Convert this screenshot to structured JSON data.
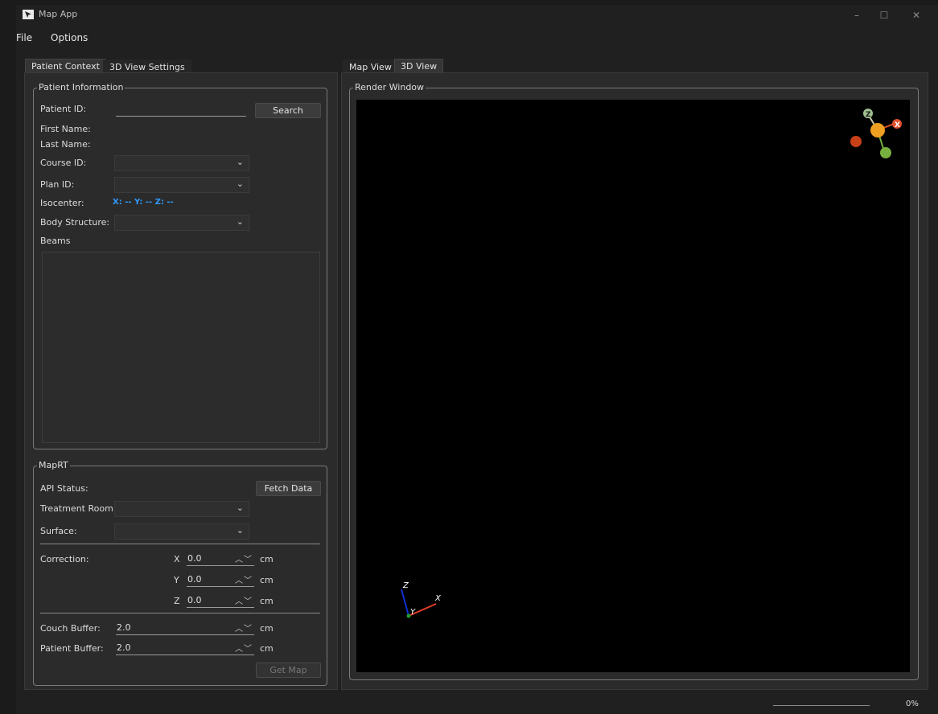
{
  "window": {
    "title": "Map App"
  },
  "menu": {
    "items": [
      "File",
      "Options"
    ]
  },
  "left_tabs": [
    {
      "label": "Patient Context",
      "active": true
    },
    {
      "label": "3D View Settings",
      "active": false
    }
  ],
  "right_tabs": [
    {
      "label": "Map View",
      "active": false
    },
    {
      "label": "3D View",
      "active": true
    }
  ],
  "patient_info": {
    "group_title": "Patient Information",
    "patient_id_label": "Patient ID:",
    "patient_id_value": "",
    "search_label": "Search",
    "first_name_label": "First Name:",
    "last_name_label": "Last Name:",
    "course_id_label": "Course ID:",
    "plan_id_label": "Plan ID:",
    "isocenter_label": "Isocenter:",
    "isocenter_value": "X: -- Y: -- Z: --",
    "body_structure_label": "Body Structure:",
    "beams_label": "Beams"
  },
  "maprt": {
    "group_title": "MapRT",
    "api_status_label": "API Status:",
    "fetch_label": "Fetch Data",
    "treatment_room_label": "Treatment Room:",
    "surface_label": "Surface:",
    "correction_label": "Correction:",
    "corrections": [
      {
        "axis": "X",
        "value": "0.0",
        "unit": "cm"
      },
      {
        "axis": "Y",
        "value": "0.0",
        "unit": "cm"
      },
      {
        "axis": "Z",
        "value": "0.0",
        "unit": "cm"
      }
    ],
    "couch_buffer_label": "Couch Buffer:",
    "couch_buffer_value": "2.0",
    "couch_buffer_unit": "cm",
    "patient_buffer_label": "Patient Buffer:",
    "patient_buffer_value": "2.0",
    "patient_buffer_unit": "cm",
    "get_map_label": "Get Map"
  },
  "render": {
    "group_title": "Render Window",
    "axis_labels": {
      "x": "X",
      "y": "Y",
      "z": "Z"
    },
    "orientation_widget_labels": {
      "z": "Z",
      "x": "X"
    },
    "colors": {
      "x_axis": "#e03a2a",
      "y_axis": "#1f9d2a",
      "z_axis": "#1030d0",
      "widget_center": "#f0a020",
      "widget_x": "#e0502a",
      "widget_y": "#78b040",
      "widget_z": "#a0c090",
      "widget_neg": "#c84018"
    }
  },
  "status": {
    "progress_text": "0%"
  }
}
